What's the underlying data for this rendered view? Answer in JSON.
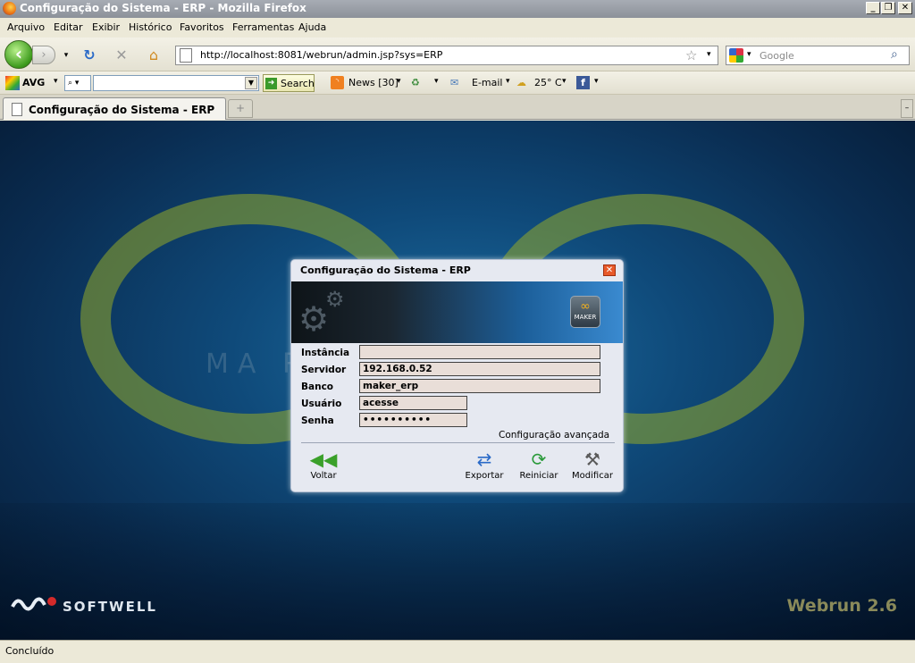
{
  "window": {
    "title": "Configuração do Sistema - ERP - Mozilla Firefox"
  },
  "menu": [
    "Arquivo",
    "Editar",
    "Exibir",
    "Histórico",
    "Favoritos",
    "Ferramentas",
    "Ajuda"
  ],
  "nav": {
    "url": "http://localhost:8081/webrun/admin.jsp?sys=ERP",
    "search_placeholder": "Google"
  },
  "avg": {
    "logo": "AVG",
    "search_btn": "Search",
    "news": "News [30]",
    "email": "E-mail",
    "weather": "25° C"
  },
  "tab": {
    "title": "Configuração do Sistema - ERP"
  },
  "background": {
    "brand_text": "MA          RLD",
    "company": "SOFTWELL",
    "product": "Webrun 2.6"
  },
  "dialog": {
    "title": "Configuração do Sistema - ERP",
    "logo_text": "MAKER",
    "fields": {
      "instancia_label": "Instância",
      "instancia_value": "",
      "servidor_label": "Servidor",
      "servidor_value": "192.168.0.52",
      "banco_label": "Banco",
      "banco_value": "maker_erp",
      "usuario_label": "Usuário",
      "usuario_value": "acesse",
      "senha_label": "Senha",
      "senha_value": "••••••••••"
    },
    "advanced_link": "Configuração avançada",
    "actions": {
      "back": "Voltar",
      "export": "Exportar",
      "restart": "Reiniciar",
      "modify": "Modificar"
    }
  },
  "status": {
    "text": "Concluído"
  }
}
